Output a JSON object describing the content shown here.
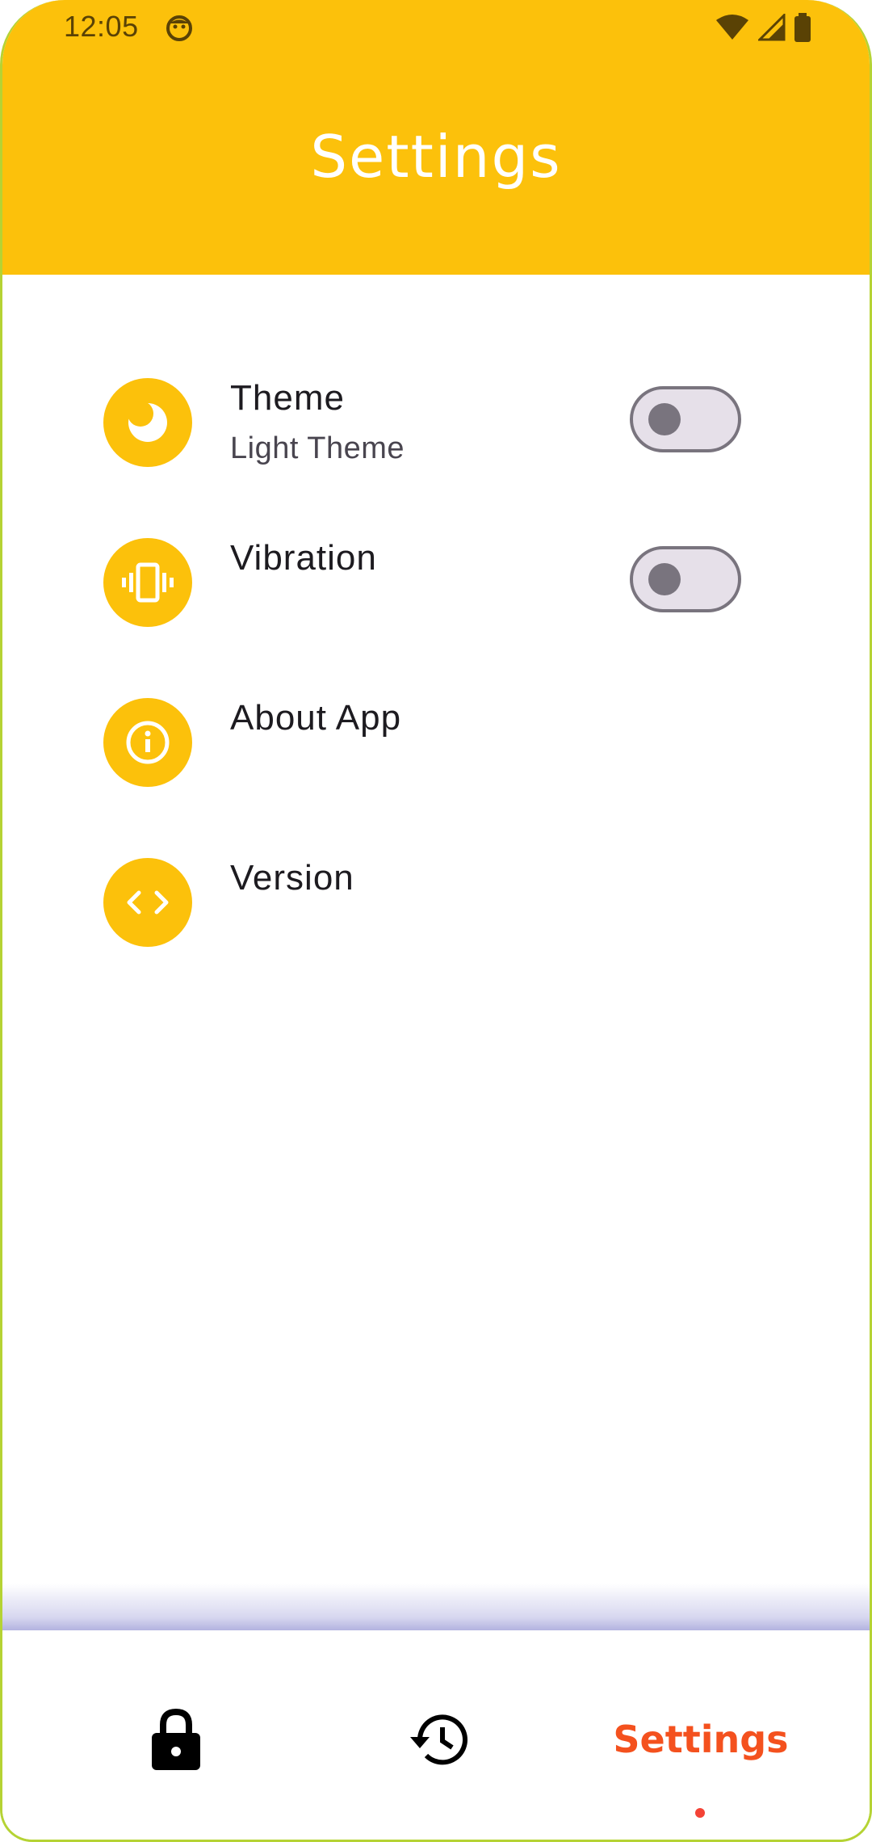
{
  "status_bar": {
    "time": "12:05",
    "icons": [
      "face-icon",
      "wifi-icon",
      "signal-icon",
      "battery-icon"
    ]
  },
  "header": {
    "title": "Settings",
    "background_color": "#fcc10b"
  },
  "settings": {
    "items": [
      {
        "title": "Theme",
        "subtitle": "Light Theme",
        "icon": "moon-icon",
        "has_toggle": true,
        "toggle_on": false
      },
      {
        "title": "Vibration",
        "subtitle": "",
        "icon": "vibration-icon",
        "has_toggle": true,
        "toggle_on": false
      },
      {
        "title": "About App",
        "subtitle": "",
        "icon": "info-icon",
        "has_toggle": false
      },
      {
        "title": "Version",
        "subtitle": "",
        "icon": "code-icon",
        "has_toggle": false
      }
    ]
  },
  "bottom_nav": {
    "items": [
      {
        "icon": "lock-icon",
        "label": ""
      },
      {
        "icon": "history-icon",
        "label": ""
      },
      {
        "icon": "",
        "label": "Settings",
        "active": true
      }
    ],
    "active_color": "#f4511e"
  }
}
